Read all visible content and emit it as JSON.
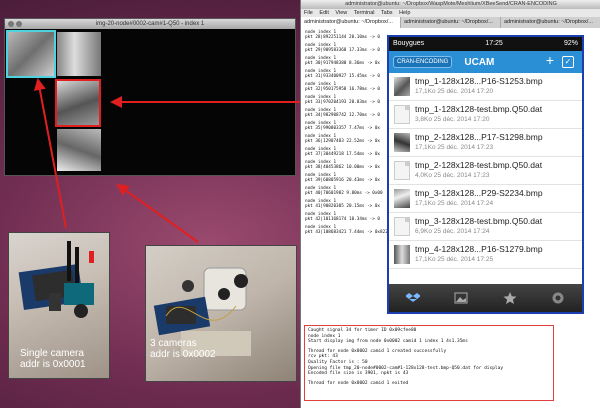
{
  "viewer": {
    "title": "img-20-node#0002-cam#1-Q50 - index 1"
  },
  "captions": {
    "single": [
      "Single camera",
      "addr is 0x0001"
    ],
    "triple": [
      "3 cameras",
      "addr is 0x0002"
    ]
  },
  "terminal": {
    "title": "administrator@ubuntu: ~/Dropbox/WaspMote/Meshlium/XBeeSend/CRAN-ENCODING",
    "menu": [
      "File",
      "Edit",
      "View",
      "Terminal",
      "Tabs",
      "Help"
    ],
    "tabs": [
      "administrator@ubuntu: ~/Dropbox/...",
      "administrator@ubuntu: ~/Dropbox/...",
      "administrator@ubuntu: ~/Dropbox/..."
    ],
    "lines": [
      "node index 1",
      "pkt 28|892251144 20.10ms -> 0",
      "node index 1",
      "pkt 29|909583368 17.33ms -> 0",
      "node index 1",
      "pkt 30|917948380 8.36ms -> 0x",
      "node index 1",
      "pkt 31|933400927 15.45ms -> 0",
      "node index 1",
      "pkt 32|950175958 16.78ms -> 0",
      "node index 1",
      "pkt 33|970204193 20.03ms -> 0",
      "node index 1",
      "pkt 34|982908742 12.70ms -> 0",
      "node index 1",
      "pkt 35|990803357 7.47ms -> 0x",
      "node index 1",
      "pkt 36|12907483 22.52ms -> 0x",
      "node index 1",
      "pkt 37|30449218 17.54ms -> 0x",
      "node index 1",
      "pkt 38|40453862 10.00ms -> 0x",
      "node index 1",
      "pkt 39|60805916 20.43ms -> 0x",
      "node index 1",
      "pkt 40|70601982 9.80ms -> 0x00",
      "node index 1",
      "pkt 41|90820305 20.15ms -> 0x",
      "node index 1",
      "pkt 42|101168174 10.34ms -> 0",
      "node index 1",
      "pkt 43|108683421 7.44ms -> 0x822.57ms), node 0x0002 camid 1 Q 50, SN 18 write 45 bytes"
    ],
    "log": [
      "Caught signal 34 for timer ID 0x09cfee80",
      "node index 1",
      "Start display img from node 0x0002 camid 1 index 1 4s1.35ms",
      "",
      "Thread for node 0x0002 camid 1 created successfully",
      "rcv pkt: 43",
      "Quality Factor is : 50",
      "Opening file tmp_20-node#0002-cam#1-128x128-test.bmp-Q50.dat for display",
      "Encoded file size is 3901, npkt is 43",
      "",
      "Thread for node 0x0002 camid 1 exited"
    ]
  },
  "phone": {
    "carrier": "Bouygues",
    "time": "17:25",
    "battery": "92%",
    "back_label": "CRAN-ENCODING",
    "title": "UCAM",
    "files": [
      {
        "name": "tmp_1-128x128...P16-S1253.bmp",
        "meta": "17,1Ko 25 déc. 2014 17:20",
        "kind": "image"
      },
      {
        "name": "tmp_1-128x128-test.bmp.Q50.dat",
        "meta": "3,8Ko 25 déc. 2014 17:20",
        "kind": "doc"
      },
      {
        "name": "tmp_2-128x128...P17-S1298.bmp",
        "meta": "17,1Ko 25 déc. 2014 17:23",
        "kind": "image"
      },
      {
        "name": "tmp_2-128x128-test.bmp.Q50.dat",
        "meta": "4,0Ko 25 déc. 2014 17:23",
        "kind": "doc"
      },
      {
        "name": "tmp_3-128x128...P29-S2234.bmp",
        "meta": "17,1Ko 25 déc. 2014 17:24",
        "kind": "image"
      },
      {
        "name": "tmp_3-128x128-test.bmp.Q50.dat",
        "meta": "6,9Ko 25 déc. 2014 17:24",
        "kind": "doc"
      },
      {
        "name": "tmp_4-128x128...P16-S1279.bmp",
        "meta": "17,1Ko 25 déc. 2014 17:25",
        "kind": "image"
      }
    ],
    "tabbar_icons": [
      "dropbox-icon",
      "photos-icon",
      "favorites-icon",
      "settings-icon"
    ]
  },
  "colors": {
    "highlight_red": "#e02020",
    "highlight_cyan": "#4fd3e0",
    "phone_frame": "#1b3fb0",
    "nav_blue": "#2b8fd6"
  }
}
